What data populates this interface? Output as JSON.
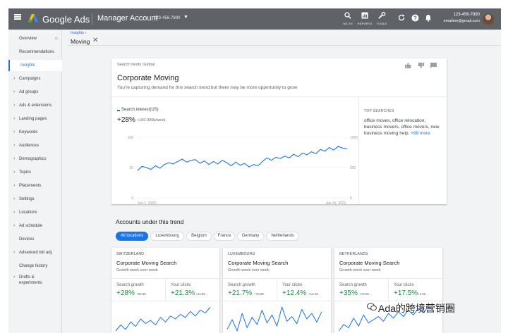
{
  "header": {
    "app_name": "Google Ads",
    "account_title": "Manager Account",
    "account_id": "123-456-7890",
    "tools": [
      {
        "label": "GO TO",
        "icon": "search-icon"
      },
      {
        "label": "REPORTS",
        "icon": "reports-icon"
      },
      {
        "label": "TOOLS",
        "icon": "wrench-icon"
      }
    ],
    "user_id": "123-456-7890",
    "user_email": "emailme@gmail.com"
  },
  "sidebar": {
    "items": [
      {
        "label": "Overview"
      },
      {
        "label": "Recommendations"
      },
      {
        "label": "Insights"
      },
      {
        "label": "Campaigns"
      },
      {
        "label": "Ad groups"
      },
      {
        "label": "Ads & extensions"
      },
      {
        "label": "Landing pages"
      },
      {
        "label": "Keywords"
      },
      {
        "label": "Audiences"
      },
      {
        "label": "Demographics"
      },
      {
        "label": "Topics"
      },
      {
        "label": "Placements"
      },
      {
        "label": "Settings"
      },
      {
        "label": "Locations"
      },
      {
        "label": "Ad schedule"
      },
      {
        "label": "Devices"
      },
      {
        "label": "Advanced bid adj."
      },
      {
        "label": "Change history"
      },
      {
        "label": "Drafts &",
        "label2": "experiments"
      }
    ]
  },
  "breadcrumb": "Insights",
  "page_title": "Moving",
  "trend_card": {
    "eyebrow": "Search trends: Global",
    "title": "Corporate Moving",
    "subtitle": "You're capturing demand for this search trend but there may be more opportunity to grow",
    "legend": "Search interest(US)",
    "change": "+28%",
    "change_sub": "+100-300k/week",
    "top_searches_heading": "TOP SEARCHES",
    "top_searches_text": "office moves, office relocation, business movers, office movers, new business moving help,",
    "top_searches_more": "+99 more"
  },
  "chart_data": {
    "type": "line",
    "title": "",
    "xlabel": "",
    "ylabel": "",
    "x_ticks": [
      "Jun 1, 2020",
      "Jan 31, 2021"
    ],
    "y_ticks": [
      "100",
      "50",
      "0"
    ],
    "y_ticks_right": [
      "1000",
      "500",
      "0"
    ],
    "ylim": [
      0,
      100
    ],
    "series": [
      {
        "name": "Search interest(US)",
        "color": "#1a73e8",
        "values": [
          45,
          52,
          50,
          47,
          53,
          49,
          55,
          58,
          56,
          60,
          64,
          59,
          62,
          63,
          57,
          61,
          55,
          60,
          56,
          62,
          58,
          53,
          59,
          54,
          57,
          51,
          55,
          53,
          60,
          66,
          62,
          67,
          65,
          69,
          66,
          72,
          68,
          74,
          71,
          76,
          73,
          80,
          77,
          83,
          79,
          85,
          82,
          81
        ]
      }
    ]
  },
  "accounts_title": "Accounts under this trend",
  "filters": [
    "All locations",
    "Luxembourg",
    "Belgium",
    "France",
    "Germany",
    "Netherlands"
  ],
  "account_cards": [
    {
      "country": "SWITZERLAND",
      "title": "Corporate Moving Search",
      "sub": "Growth week over week",
      "growth_label": "Search growth",
      "growth": "+28%",
      "growth_sub": "+65.8K",
      "clicks_label": "Your clicks",
      "clicks": "+21.3%",
      "clicks_sub": "+23.6K",
      "spark": [
        30,
        34,
        31,
        36,
        33,
        38,
        35,
        37,
        34,
        39,
        36,
        40,
        38,
        41,
        39,
        43,
        40,
        44,
        42,
        46
      ]
    },
    {
      "country": "LUXEMBOURG",
      "title": "Corporate Moving Search",
      "sub": "Growth week over week",
      "growth_label": "Search growth",
      "growth": "+21.7%",
      "growth_sub": "+76.8K",
      "clicks_label": "Your clicks",
      "clicks": "+12.4%",
      "clicks_sub": "+12.2K",
      "spark": [
        20,
        32,
        18,
        40,
        22,
        35,
        26,
        44,
        28,
        38,
        24,
        48,
        30,
        36,
        27,
        45,
        33,
        40,
        29,
        42
      ]
    },
    {
      "country": "NETHERLANDS",
      "title": "Corporate Moving Search",
      "sub": "Growth week over week",
      "growth_label": "Search growth",
      "growth": "+35%",
      "growth_sub": "+79.5K",
      "clicks_label": "Your clicks",
      "clicks": "+17.5%",
      "clicks_sub": "+4.6K",
      "spark": [
        22,
        30,
        26,
        38,
        28,
        42,
        32,
        36,
        40,
        34,
        44,
        38,
        46,
        40,
        48,
        42,
        50,
        45,
        52,
        48
      ]
    }
  ],
  "watermark": "Ada的跨境营销圈"
}
